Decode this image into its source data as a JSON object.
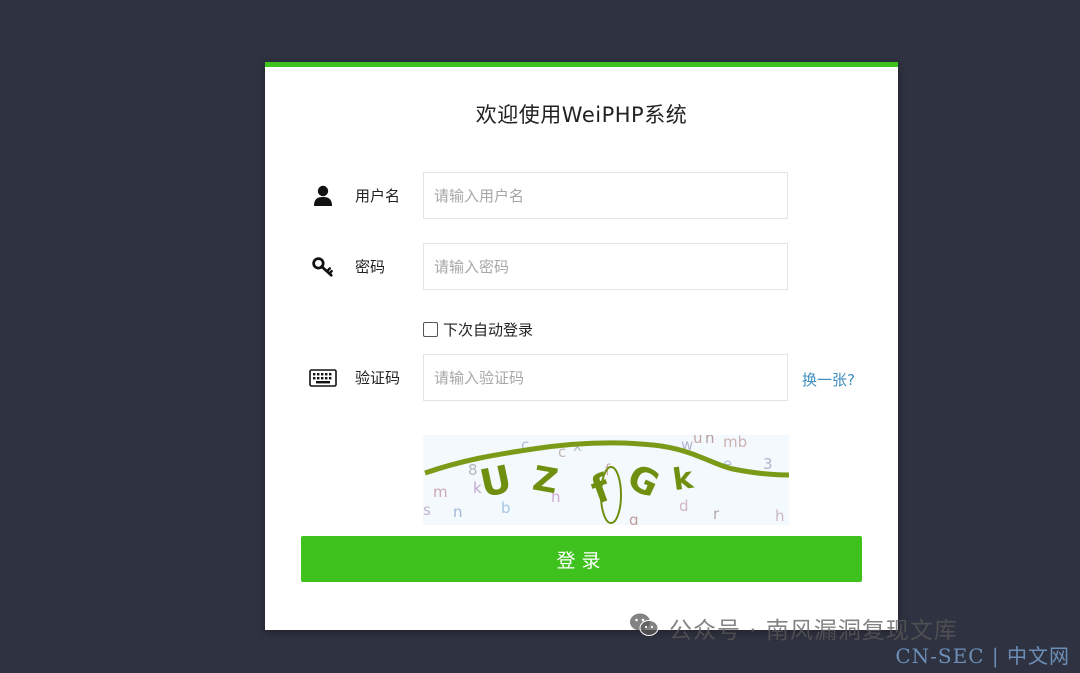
{
  "login": {
    "title": "欢迎使用WeiPHP系统",
    "username": {
      "icon": "user-icon",
      "label": "用户名",
      "placeholder": "请输入用户名",
      "value": ""
    },
    "password": {
      "icon": "key-icon",
      "label": "密码",
      "placeholder": "请输入密码",
      "value": ""
    },
    "remember_label": "下次自动登录",
    "captcha": {
      "icon": "keyboard-icon",
      "label": "验证码",
      "placeholder": "请输入验证码",
      "value": "",
      "refresh_label": "换一张?",
      "image_text": "UZfGk"
    },
    "submit_label": "登录"
  },
  "watermark": {
    "wechat_text": "公众号 · 南风漏洞复现文库",
    "site_text": "CN-SEC | 中文网"
  },
  "colors": {
    "background": "#2f3240",
    "accent": "#3fc11e",
    "link": "#3f8fc0"
  }
}
